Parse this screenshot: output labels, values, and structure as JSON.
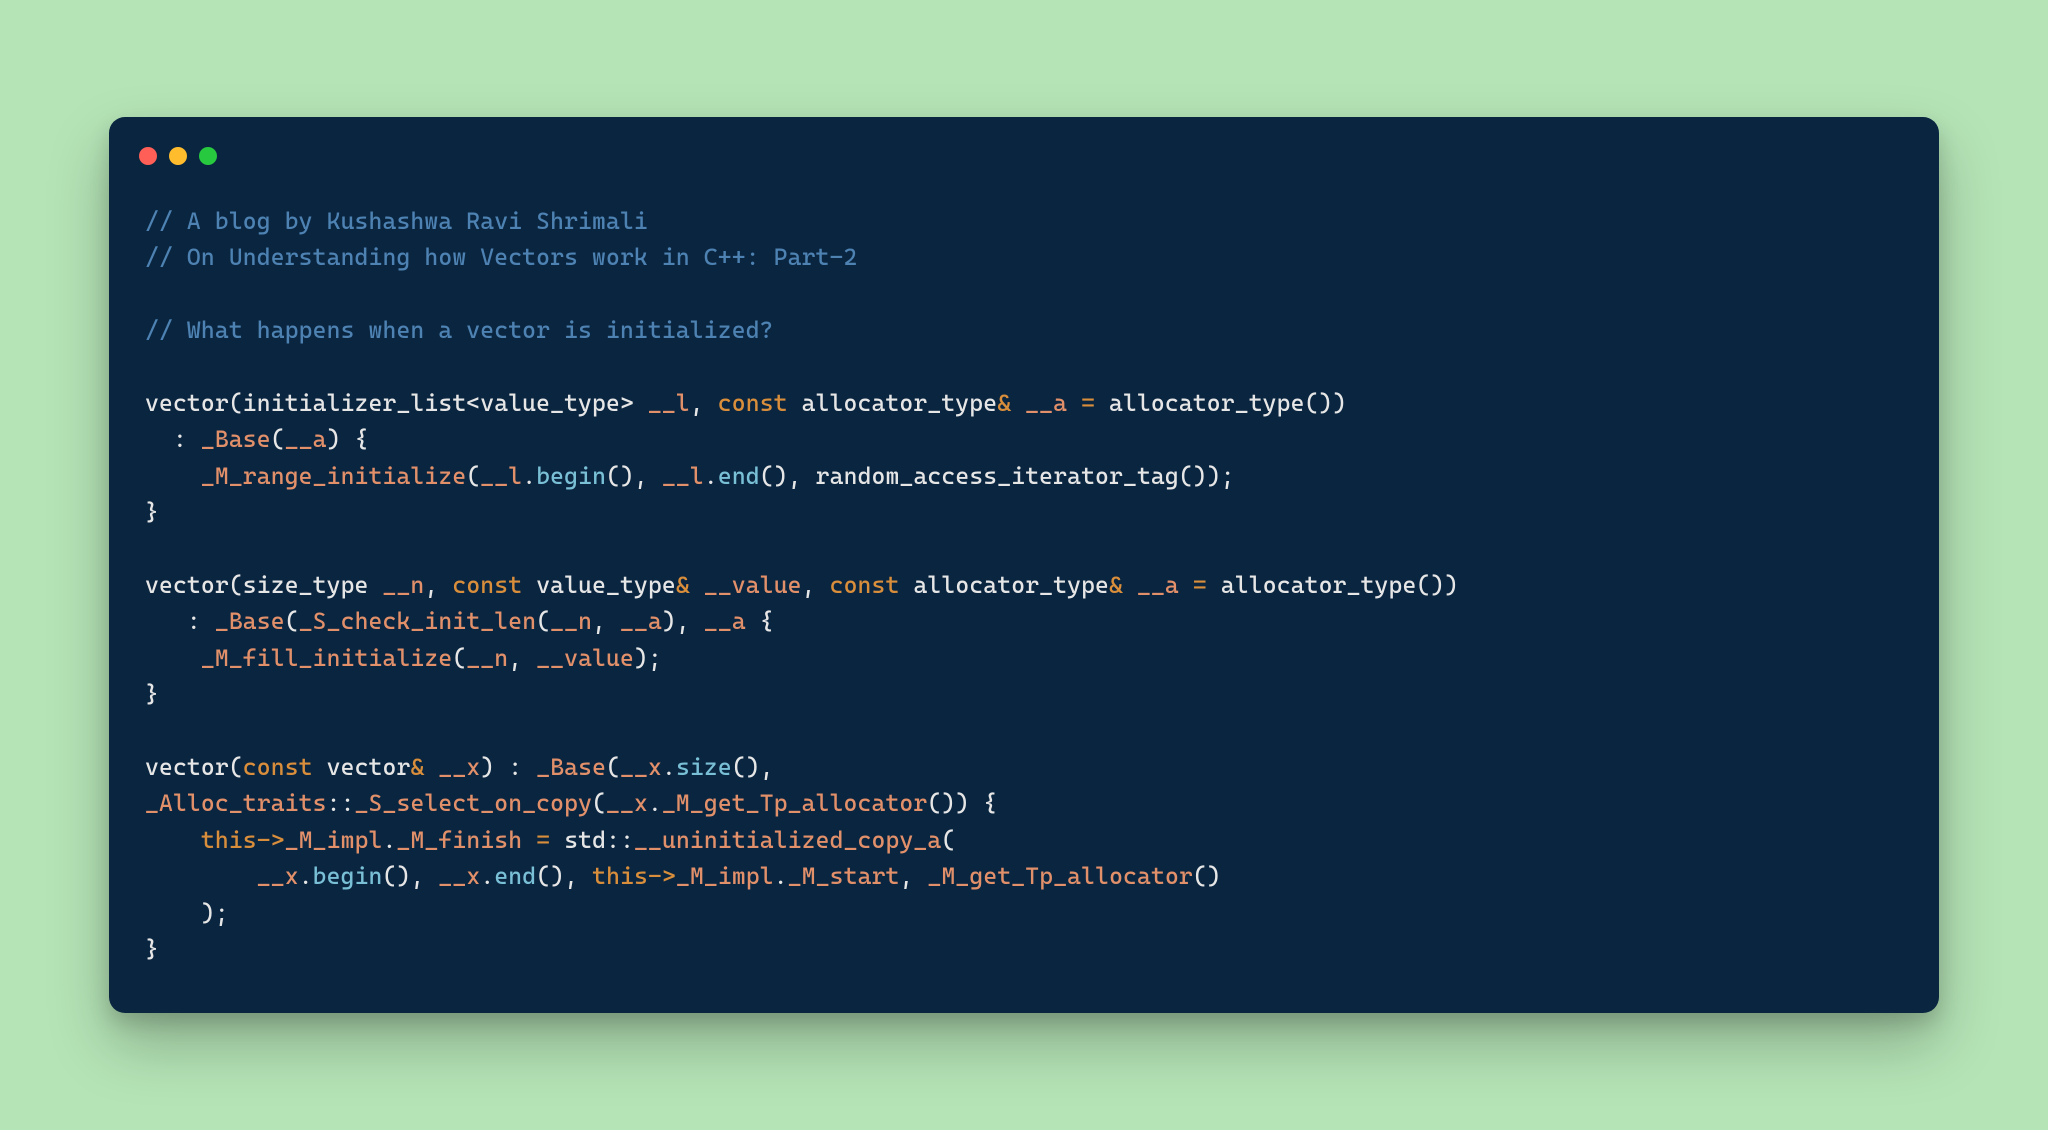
{
  "colors": {
    "background_page": "#b5e4b6",
    "background_window": "#0a2540",
    "traffic_red": "#ff5f56",
    "traffic_yellow": "#ffbd2e",
    "traffic_green": "#27c93f",
    "comment": "#4d82b2",
    "keyword": "#d98e3b",
    "identifier_underscore": "#e2906a",
    "method": "#79c0d6",
    "default_text": "#e6e6e6"
  },
  "comments": {
    "c1": "// A blog by Kushashwa Ravi Shrimali",
    "c2": "// On Understanding how Vectors work in C++: Part-2",
    "c3": "// What happens when a vector is initialized?"
  },
  "code": {
    "l1_a": "vector(initializer_list<value_type> ",
    "l1_b": "__l",
    "l1_c": ", ",
    "l1_d": "const",
    "l1_e": " allocator_type",
    "l1_f": "&",
    "l1_g": " ",
    "l1_h": "__a",
    "l1_i": " ",
    "l1_j": "=",
    "l1_k": " allocator_type())",
    "l2_a": "  : ",
    "l2_b": "_Base",
    "l2_c": "(",
    "l2_d": "__a",
    "l2_e": ") {",
    "l3_a": "    ",
    "l3_b": "_M_range_initialize",
    "l3_c": "(",
    "l3_d": "__l",
    "l3_e": ".",
    "l3_f": "begin",
    "l3_g": "(), ",
    "l3_h": "__l",
    "l3_i": ".",
    "l3_j": "end",
    "l3_k": "(), random_access_iterator_tag());",
    "l4_a": "}",
    "l6_a": "vector(size_type ",
    "l6_b": "__n",
    "l6_c": ", ",
    "l6_d": "const",
    "l6_e": " value_type",
    "l6_f": "&",
    "l6_g": " ",
    "l6_h": "__value",
    "l6_i": ", ",
    "l6_j": "const",
    "l6_k": " allocator_type",
    "l6_l": "&",
    "l6_m": " ",
    "l6_n": "__a",
    "l6_o": " ",
    "l6_p": "=",
    "l6_q": " allocator_type())",
    "l7_a": "   : ",
    "l7_b": "_Base",
    "l7_c": "(",
    "l7_d": "_S_check_init_len",
    "l7_e": "(",
    "l7_f": "__n",
    "l7_g": ", ",
    "l7_h": "__a",
    "l7_i": "), ",
    "l7_j": "__a",
    "l7_k": " {",
    "l8_a": "    ",
    "l8_b": "_M_fill_initialize",
    "l8_c": "(",
    "l8_d": "__n",
    "l8_e": ", ",
    "l8_f": "__value",
    "l8_g": ");",
    "l9_a": "}",
    "l11_a": "vector(",
    "l11_b": "const",
    "l11_c": " vector",
    "l11_d": "&",
    "l11_e": " ",
    "l11_f": "__x",
    "l11_g": ") : ",
    "l11_h": "_Base",
    "l11_i": "(",
    "l11_j": "__x",
    "l11_k": ".",
    "l11_l": "size",
    "l11_m": "(),",
    "l12_a": "_Alloc_traits",
    "l12_b": "::",
    "l12_c": "_S_select_on_copy",
    "l12_d": "(",
    "l12_e": "__x",
    "l12_f": ".",
    "l12_g": "_M_get_Tp_allocator",
    "l12_h": "()) {",
    "l13_a": "    ",
    "l13_b": "this",
    "l13_c": "->",
    "l13_d": "_M_impl",
    "l13_e": ".",
    "l13_f": "_M_finish",
    "l13_g": " ",
    "l13_h": "=",
    "l13_i": " std::",
    "l13_j": "__uninitialized_copy_a",
    "l13_k": "(",
    "l14_a": "        ",
    "l14_b": "__x",
    "l14_c": ".",
    "l14_d": "begin",
    "l14_e": "(), ",
    "l14_f": "__x",
    "l14_g": ".",
    "l14_h": "end",
    "l14_i": "(), ",
    "l14_j": "this",
    "l14_k": "->",
    "l14_l": "_M_impl",
    "l14_m": ".",
    "l14_n": "_M_start",
    "l14_o": ", ",
    "l14_p": "_M_get_Tp_allocator",
    "l14_q": "()",
    "l15_a": "    );",
    "l16_a": "}"
  }
}
